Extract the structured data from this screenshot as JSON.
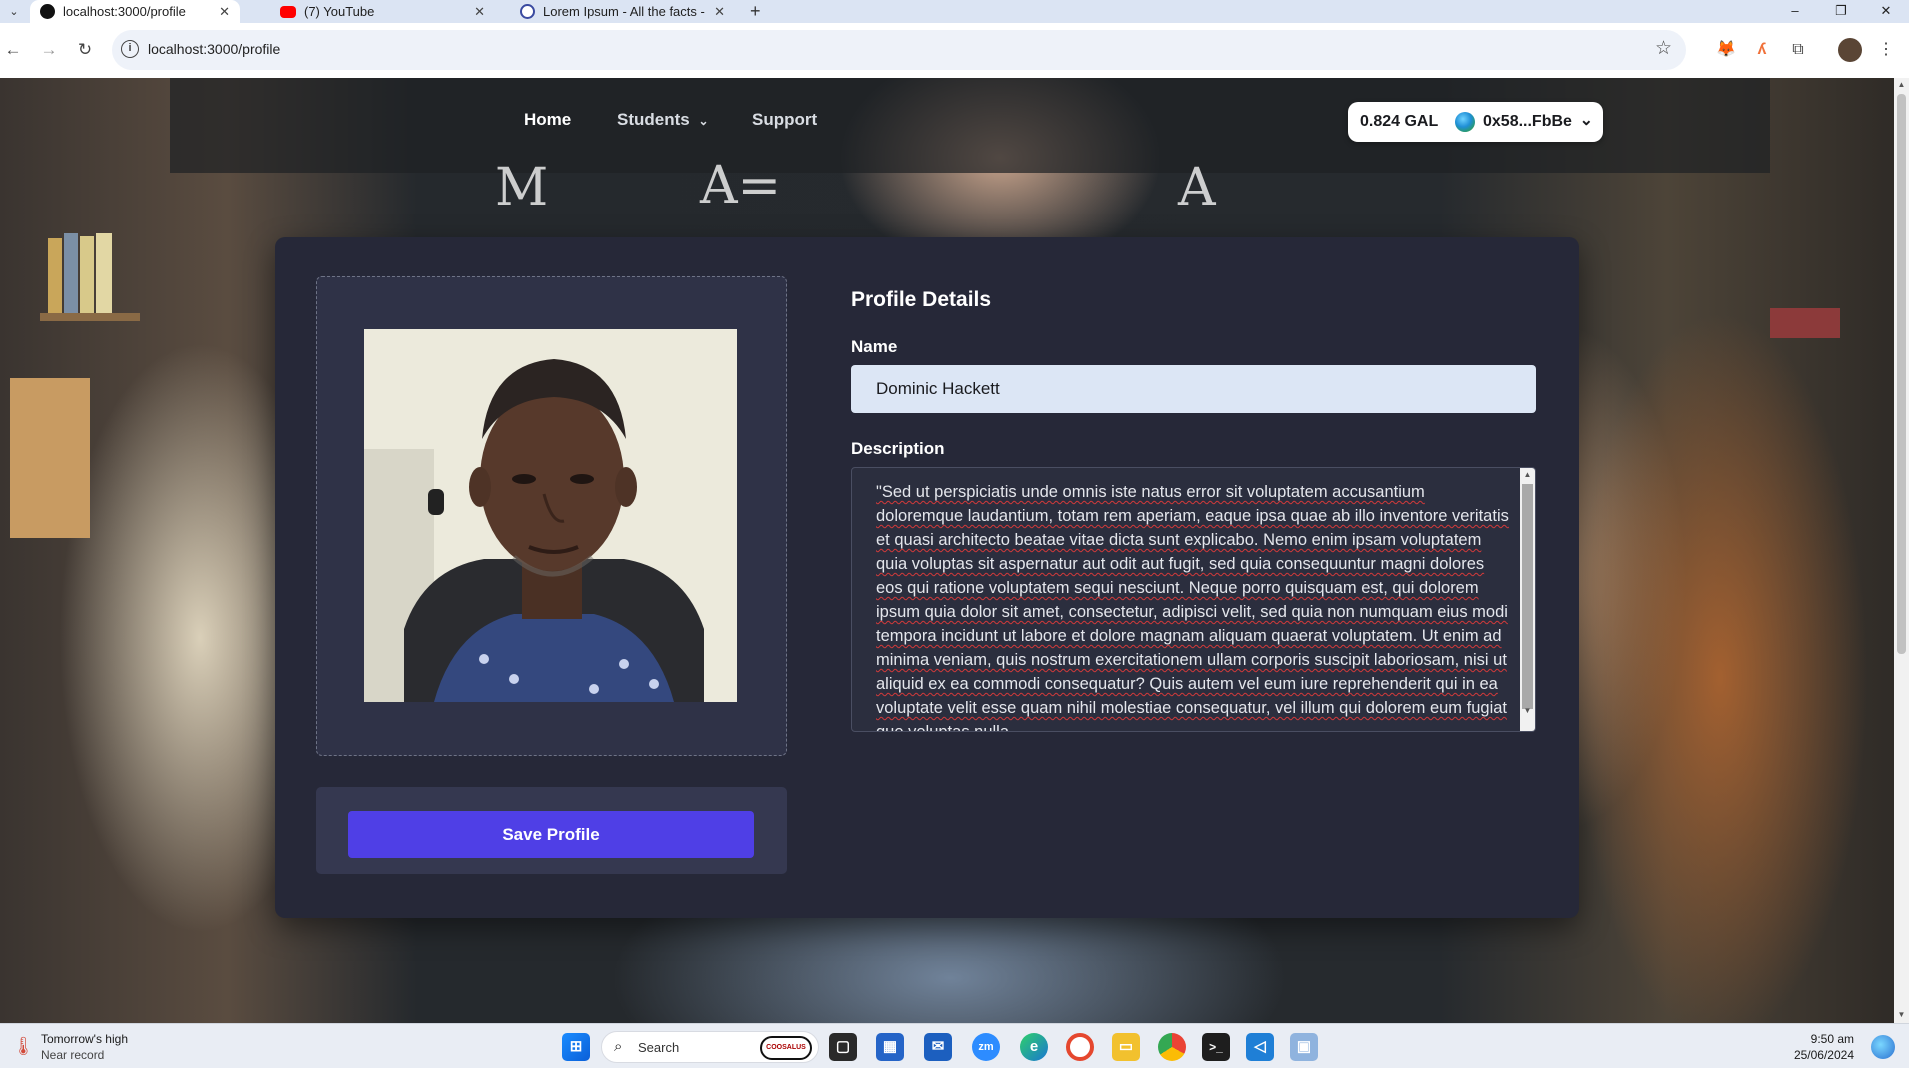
{
  "browser": {
    "tabs": [
      {
        "title": "localhost:3000/profile",
        "active": true,
        "favicon": "localhost-favicon-icon"
      },
      {
        "title": "(7) YouTube",
        "active": false,
        "favicon": "youtube-icon"
      },
      {
        "title": "Lorem Ipsum - All the facts - Lip",
        "active": false,
        "favicon": "lipsum-icon"
      }
    ],
    "url": "localhost:3000/profile",
    "new_tab": "+",
    "window_controls": [
      "–",
      "❐",
      "✕"
    ]
  },
  "nav": {
    "home": "Home",
    "students": "Students",
    "support": "Support"
  },
  "wallet": {
    "balance": "0.824 GAL",
    "address": "0x58...FbBe"
  },
  "profile": {
    "heading": "Profile Details",
    "name_label": "Name",
    "name_value": "Dominic Hackett",
    "description_label": "Description",
    "description_value": "\"Sed ut perspiciatis unde omnis iste natus error sit voluptatem accusantium doloremque laudantium, totam rem aperiam, eaque ipsa quae ab illo inventore veritatis et quasi architecto beatae vitae dicta sunt explicabo. Nemo enim ipsam voluptatem quia voluptas sit aspernatur aut odit aut fugit, sed quia consequuntur magni dolores eos qui ratione voluptatem sequi nesciunt. Neque porro quisquam est, qui dolorem ipsum quia dolor sit amet, consectetur, adipisci velit, sed quia non numquam eius modi tempora incidunt ut labore et dolore magnam aliquam quaerat voluptatem. Ut enim ad minima veniam, quis nostrum exercitationem ullam corporis suscipit laboriosam, nisi ut aliquid ex ea commodi consequatur? Quis autem vel eum iure reprehenderit qui in ea voluptate velit esse quam nihil molestiae consequatur, vel illum qui dolorem eum fugiat quo voluptas nulla",
    "save_label": "Save Profile"
  },
  "taskbar": {
    "weather_title": "Tomorrow's high",
    "weather_sub": "Near record",
    "search_placeholder": "Search",
    "search_badge": "COOSALUS",
    "time": "9:50 am",
    "date": "25/06/2024"
  },
  "colors": {
    "accent": "#4f3fe6",
    "card": "#262838",
    "input": "#dce6f5"
  }
}
